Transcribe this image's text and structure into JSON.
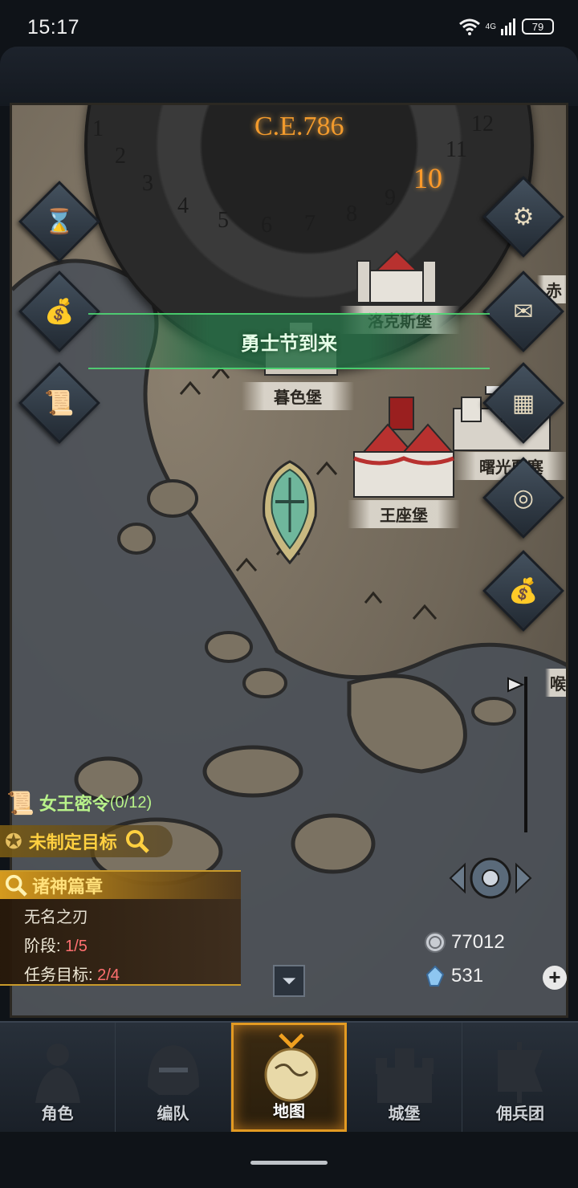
{
  "status_bar": {
    "time": "15:17",
    "network": "4G",
    "battery": "79"
  },
  "era": {
    "label": "C.E.786",
    "months": [
      "1",
      "2",
      "3",
      "4",
      "5",
      "6",
      "7",
      "8",
      "9",
      "10",
      "11",
      "12"
    ],
    "current_month": "10"
  },
  "event_banner": {
    "text": "勇士节到来"
  },
  "towns": [
    {
      "name": "洛克斯堡"
    },
    {
      "name": "暮色堡"
    },
    {
      "name": "曙光要塞"
    },
    {
      "name": "王座堡"
    },
    {
      "name": "赤"
    },
    {
      "name": "喉"
    }
  ],
  "side_buttons": [
    "hourglass-icon",
    "money-bag-icon",
    "scroll-icon",
    "gear-icon",
    "mail-icon",
    "formation-icon",
    "coin-icon",
    "treasure-bags-icon"
  ],
  "quests": {
    "royal_order": {
      "label": "女王密令",
      "count": "(0/12)"
    },
    "goal": {
      "label": "未制定目标"
    },
    "chapter": {
      "title": "诸神篇章",
      "subtitle": "无名之刃",
      "stage_label": "阶段:",
      "stage_value": "1/5",
      "task_label": "任务目标:",
      "task_value": "2/4"
    }
  },
  "currency": {
    "silver": "77012",
    "crystal": "531"
  },
  "nav": [
    {
      "label": "角色",
      "icon": "knight-icon",
      "active": false
    },
    {
      "label": "编队",
      "icon": "helmet-icon",
      "active": false
    },
    {
      "label": "地图",
      "icon": "globe-icon",
      "active": true
    },
    {
      "label": "城堡",
      "icon": "castle-icon",
      "active": false
    },
    {
      "label": "佣兵团",
      "icon": "banner-icon",
      "active": false
    }
  ]
}
